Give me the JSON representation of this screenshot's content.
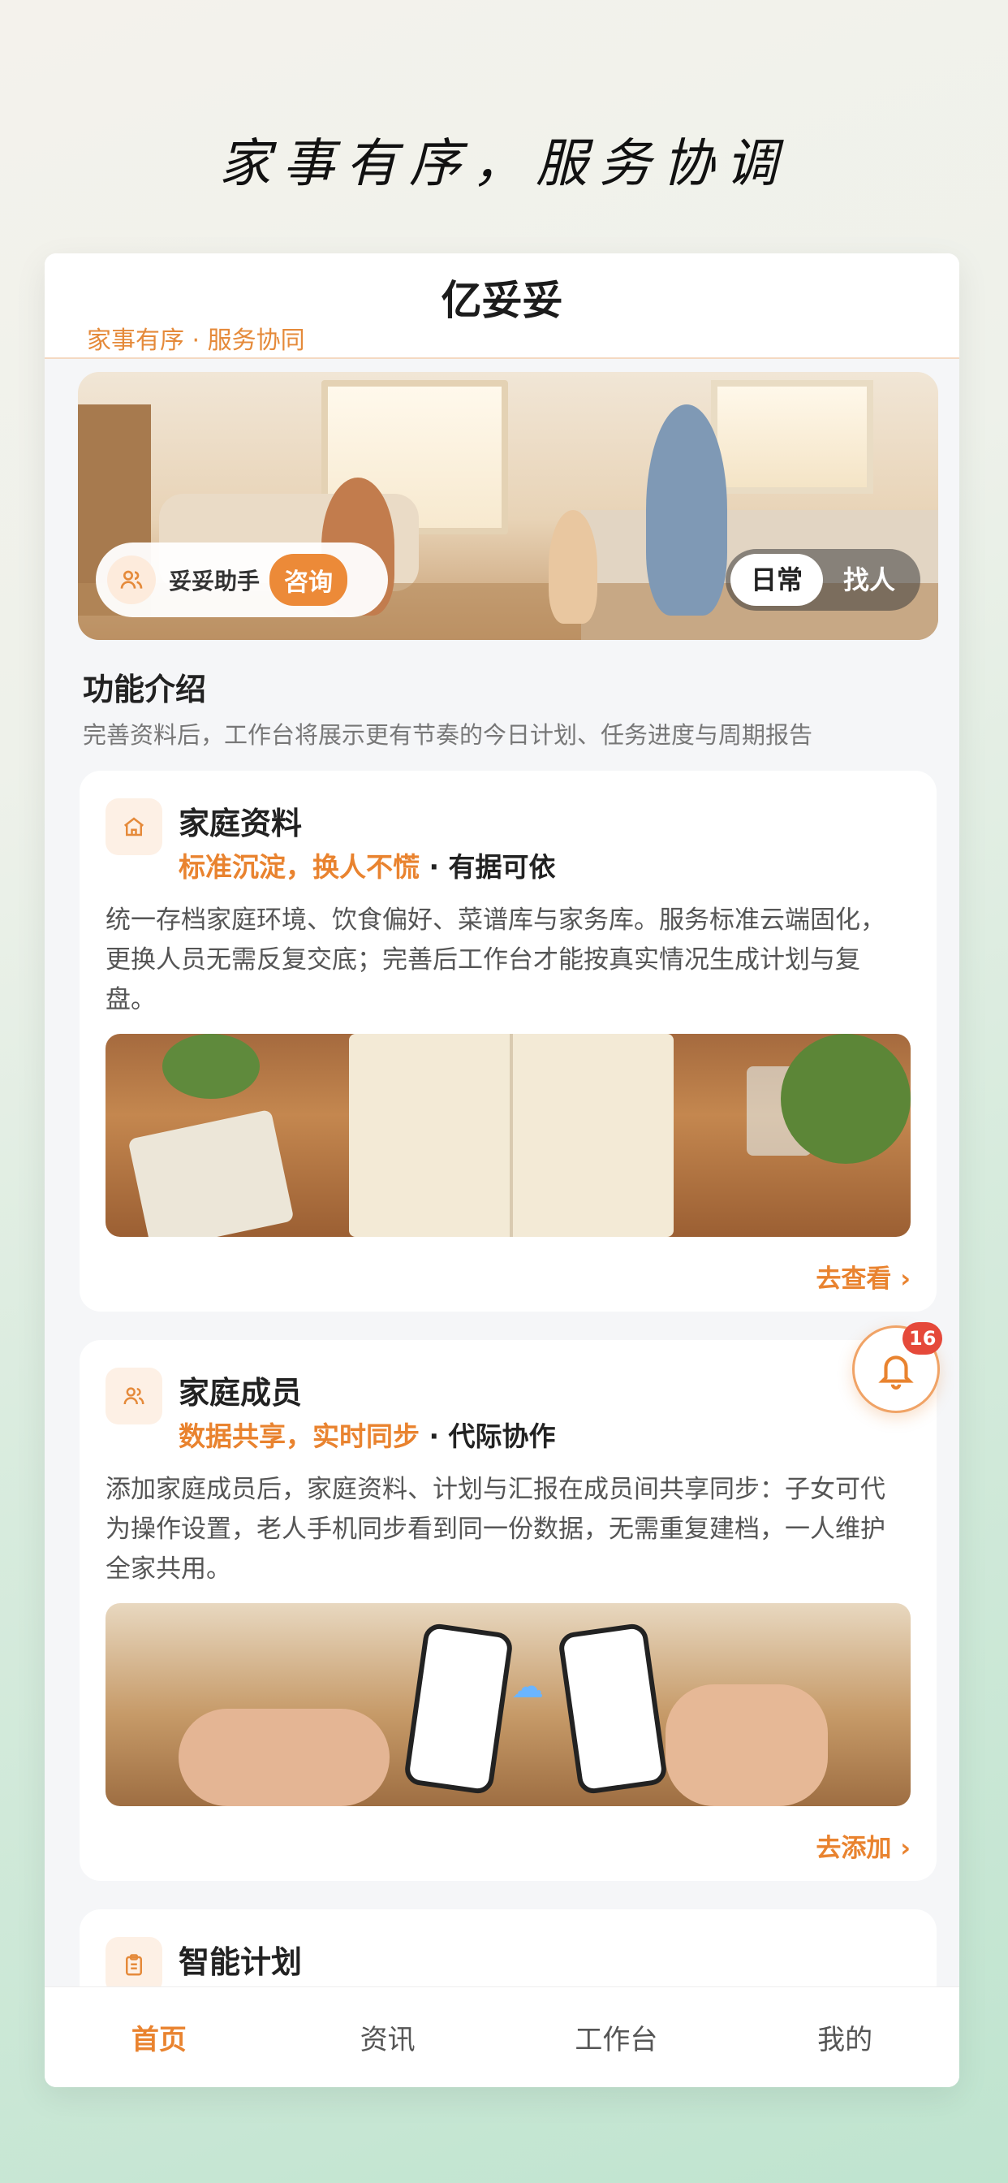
{
  "headline": "家事有序，服务协调",
  "nav": {
    "title": "亿妥妥",
    "subtitle": "家事有序 · 服务协同"
  },
  "hero": {
    "assistant_label": "妥妥助手",
    "consult_button": "咨询",
    "segments": [
      "日常",
      "找人"
    ],
    "active_segment": "日常"
  },
  "section": {
    "title": "功能介绍",
    "subtitle": "完善资料后，工作台将展示更有节奏的今日计划、任务进度与周期报告"
  },
  "cards": [
    {
      "icon": "home-icon",
      "title": "家庭资料",
      "tag_highlight": "标准沉淀，换人不慌",
      "tag_rest": "· 有据可依",
      "description": "统一存档家庭环境、饮食偏好、菜谱库与家务库。服务标准云端固化，更换人员无需反复交底；完善后工作台才能按真实情况生成计划与复盘。",
      "link": "去查看 ›"
    },
    {
      "icon": "users-icon",
      "title": "家庭成员",
      "tag_highlight": "数据共享，实时同步",
      "tag_rest": "· 代际协作",
      "description": "添加家庭成员后，家庭资料、计划与汇报在成员间共享同步：子女可代为操作设置，老人手机同步看到同一份数据，无需重复建档，一人维护全家共用。",
      "link": "去添加 ›"
    },
    {
      "icon": "clipboard-icon",
      "title": "智能计划"
    }
  ],
  "notification": {
    "count": "16"
  },
  "tabs": [
    "首页",
    "资讯",
    "工作台",
    "我的"
  ],
  "active_tab": "首页",
  "colors": {
    "accent": "#e9832f",
    "badge": "#e5493a"
  }
}
